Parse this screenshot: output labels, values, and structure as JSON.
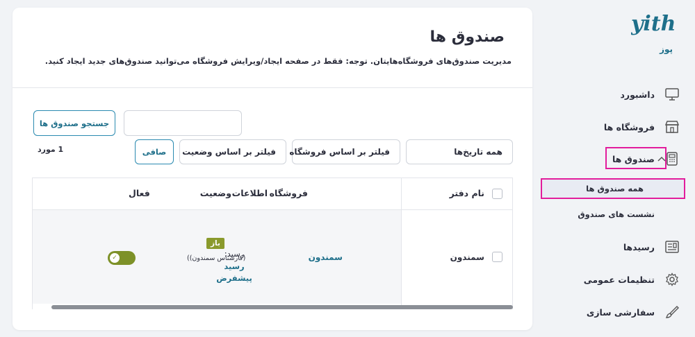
{
  "brand": {
    "logo_text": "yith",
    "name": "پوز"
  },
  "sidebar": {
    "items": [
      {
        "label": "داشبورد",
        "icon": "monitor-icon"
      },
      {
        "label": "فروشگاه ها",
        "icon": "store-icon"
      },
      {
        "label": "صندوق ها",
        "icon": "register-icon"
      },
      {
        "label": "رسیدها",
        "icon": "receipt-icon"
      },
      {
        "label": "تنظیمات عمومی",
        "icon": "gear-icon"
      },
      {
        "label": "سفارشی سازی",
        "icon": "brush-icon"
      }
    ],
    "subitems": [
      {
        "label": "همه صندوق ها"
      },
      {
        "label": "نشست های صندوق"
      }
    ]
  },
  "main": {
    "title": "صندوق ها",
    "description": "مدیریت صندوق‌های فروشگاه‌هایتان. توجه: فقط در صفحه ایجاد/ویرایش فروشگاه می‌توانید صندوق‌های جدید ایجاد کنید.",
    "search": {
      "button_label": "جستجو صندوق ها",
      "value": ""
    },
    "filters": {
      "dates": "همه تاریخ‌ها",
      "store": "فیلتر بر اساس فروشگاه",
      "status": "فیلتر بر اساس وضعیت",
      "apply_label": "صافی"
    },
    "item_count": "1 مورد",
    "table": {
      "columns": [
        "نام دفتر",
        "فروشگاه",
        "اطلاعات",
        "وضعیت",
        "فعال"
      ],
      "rows": [
        {
          "name": "سمندون",
          "store": "سمندون",
          "info_label": "رسید:",
          "info_value": "رسید پیشفرض",
          "status_badge": "باز",
          "status_detail": "(کارشناس سمندون))",
          "active": true
        }
      ]
    }
  },
  "colors": {
    "accent": "#1e6f8a",
    "highlight": "#e21c9c",
    "toggle": "#7d9128"
  }
}
